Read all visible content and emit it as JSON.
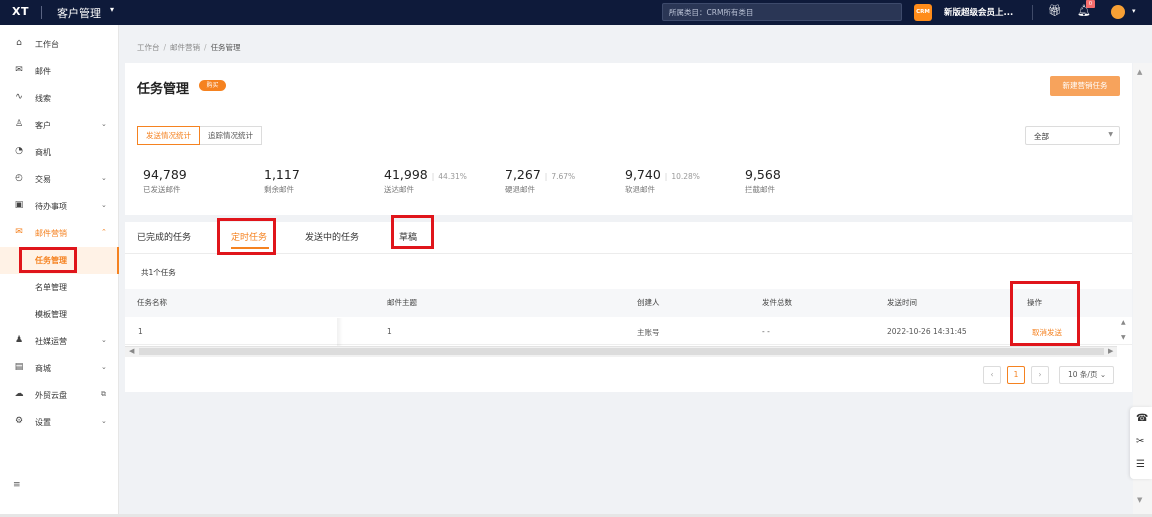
{
  "topbar": {
    "logo": "XT",
    "app_title": "客户管理",
    "app_caret": "▾",
    "search_placeholder": "所属类目：CRM所有类目",
    "crm_badge": "CRM",
    "promo": "新版超级会员上...",
    "notification_count": "0"
  },
  "sidebar": {
    "items": [
      {
        "label": "工作台",
        "icon": "⌂"
      },
      {
        "label": "邮件",
        "icon": "✉"
      },
      {
        "label": "线索",
        "icon": "∿"
      },
      {
        "label": "客户",
        "icon": "♙",
        "caret": "⌄"
      },
      {
        "label": "商机",
        "icon": "◔"
      },
      {
        "label": "交易",
        "icon": "◴",
        "caret": "⌄"
      },
      {
        "label": "待办事项",
        "icon": "▣",
        "caret": "⌄"
      },
      {
        "label": "邮件营销",
        "icon": "✉",
        "caret": "⌃"
      },
      {
        "label": "社媒运营",
        "icon": "♟",
        "caret": "⌄"
      },
      {
        "label": "商城",
        "icon": "▤",
        "caret": "⌄"
      },
      {
        "label": "外贸云盘",
        "icon": "☁",
        "caret": "⧉"
      },
      {
        "label": "设置",
        "icon": "⚙",
        "caret": "⌄"
      }
    ],
    "sub_items": [
      "任务管理",
      "名单管理",
      "模板管理"
    ],
    "collapse_icon": "≡"
  },
  "breadcrumb": [
    "工作台",
    "邮件营销",
    "任务管理"
  ],
  "page": {
    "title": "任务管理",
    "badge": "购买",
    "new_task_button": "新建营销任务"
  },
  "stat_tabs": [
    "发送情况统计",
    "追踪情况统计"
  ],
  "filter_select": "全部",
  "stats": [
    {
      "value": "94,789",
      "label": "已发送邮件",
      "pct": ""
    },
    {
      "value": "1,117",
      "label": "剩余邮件",
      "pct": ""
    },
    {
      "value": "41,998",
      "label": "送达邮件",
      "pct": "44.31%"
    },
    {
      "value": "7,267",
      "label": "硬退邮件",
      "pct": "7.67%"
    },
    {
      "value": "9,740",
      "label": "软退邮件",
      "pct": "10.28%"
    },
    {
      "value": "9,568",
      "label": "拦截邮件",
      "pct": ""
    }
  ],
  "task_tabs": [
    "已完成的任务",
    "定时任务",
    "发送中的任务",
    "草稿"
  ],
  "count_text": "共1个任务",
  "table": {
    "columns": [
      "任务名称",
      "邮件主题",
      "创建人",
      "发件总数",
      "发送时间",
      "操作"
    ],
    "rows": [
      {
        "name": "1",
        "subject": "1",
        "creator": "主账号",
        "total": "- -",
        "time": "2022-10-26 14:31:45",
        "action": "取消发送"
      }
    ]
  },
  "pagination": {
    "prev": "‹",
    "current": "1",
    "next": "›",
    "page_size": "10 条/页 ⌄"
  },
  "colors": {
    "accent": "#f58220",
    "topbar": "#0e1a3a",
    "highlight": "#e0151b"
  }
}
